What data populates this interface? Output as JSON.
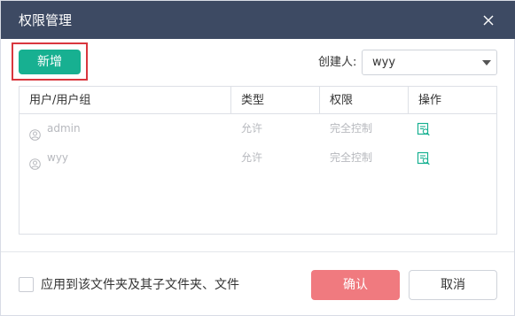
{
  "dialog": {
    "title": "权限管理",
    "close_icon": "close-icon"
  },
  "toolbar": {
    "add_label": "新增",
    "creator_label": "创建人:",
    "creator_value": "wyy",
    "creator_caret_icon": "caret-down-icon"
  },
  "table": {
    "headers": [
      "用户/用户组",
      "类型",
      "权限",
      "操作"
    ],
    "rows": [
      {
        "user": "admin",
        "type": "允许",
        "permission": "完全控制",
        "user_icon": "user-icon",
        "op_icon": "edit-permission-icon"
      },
      {
        "user": "wyy",
        "type": "允许",
        "permission": "完全控制",
        "user_icon": "user-icon",
        "op_icon": "edit-permission-icon"
      }
    ]
  },
  "footer": {
    "apply_label": "应用到该文件夹及其子文件夹、文件",
    "confirm_label": "确认",
    "cancel_label": "取消"
  },
  "colors": {
    "titlebar": "#3d4a63",
    "primary": "#17b091",
    "confirm": "#f07a7f",
    "highlight": "#d9363e"
  }
}
